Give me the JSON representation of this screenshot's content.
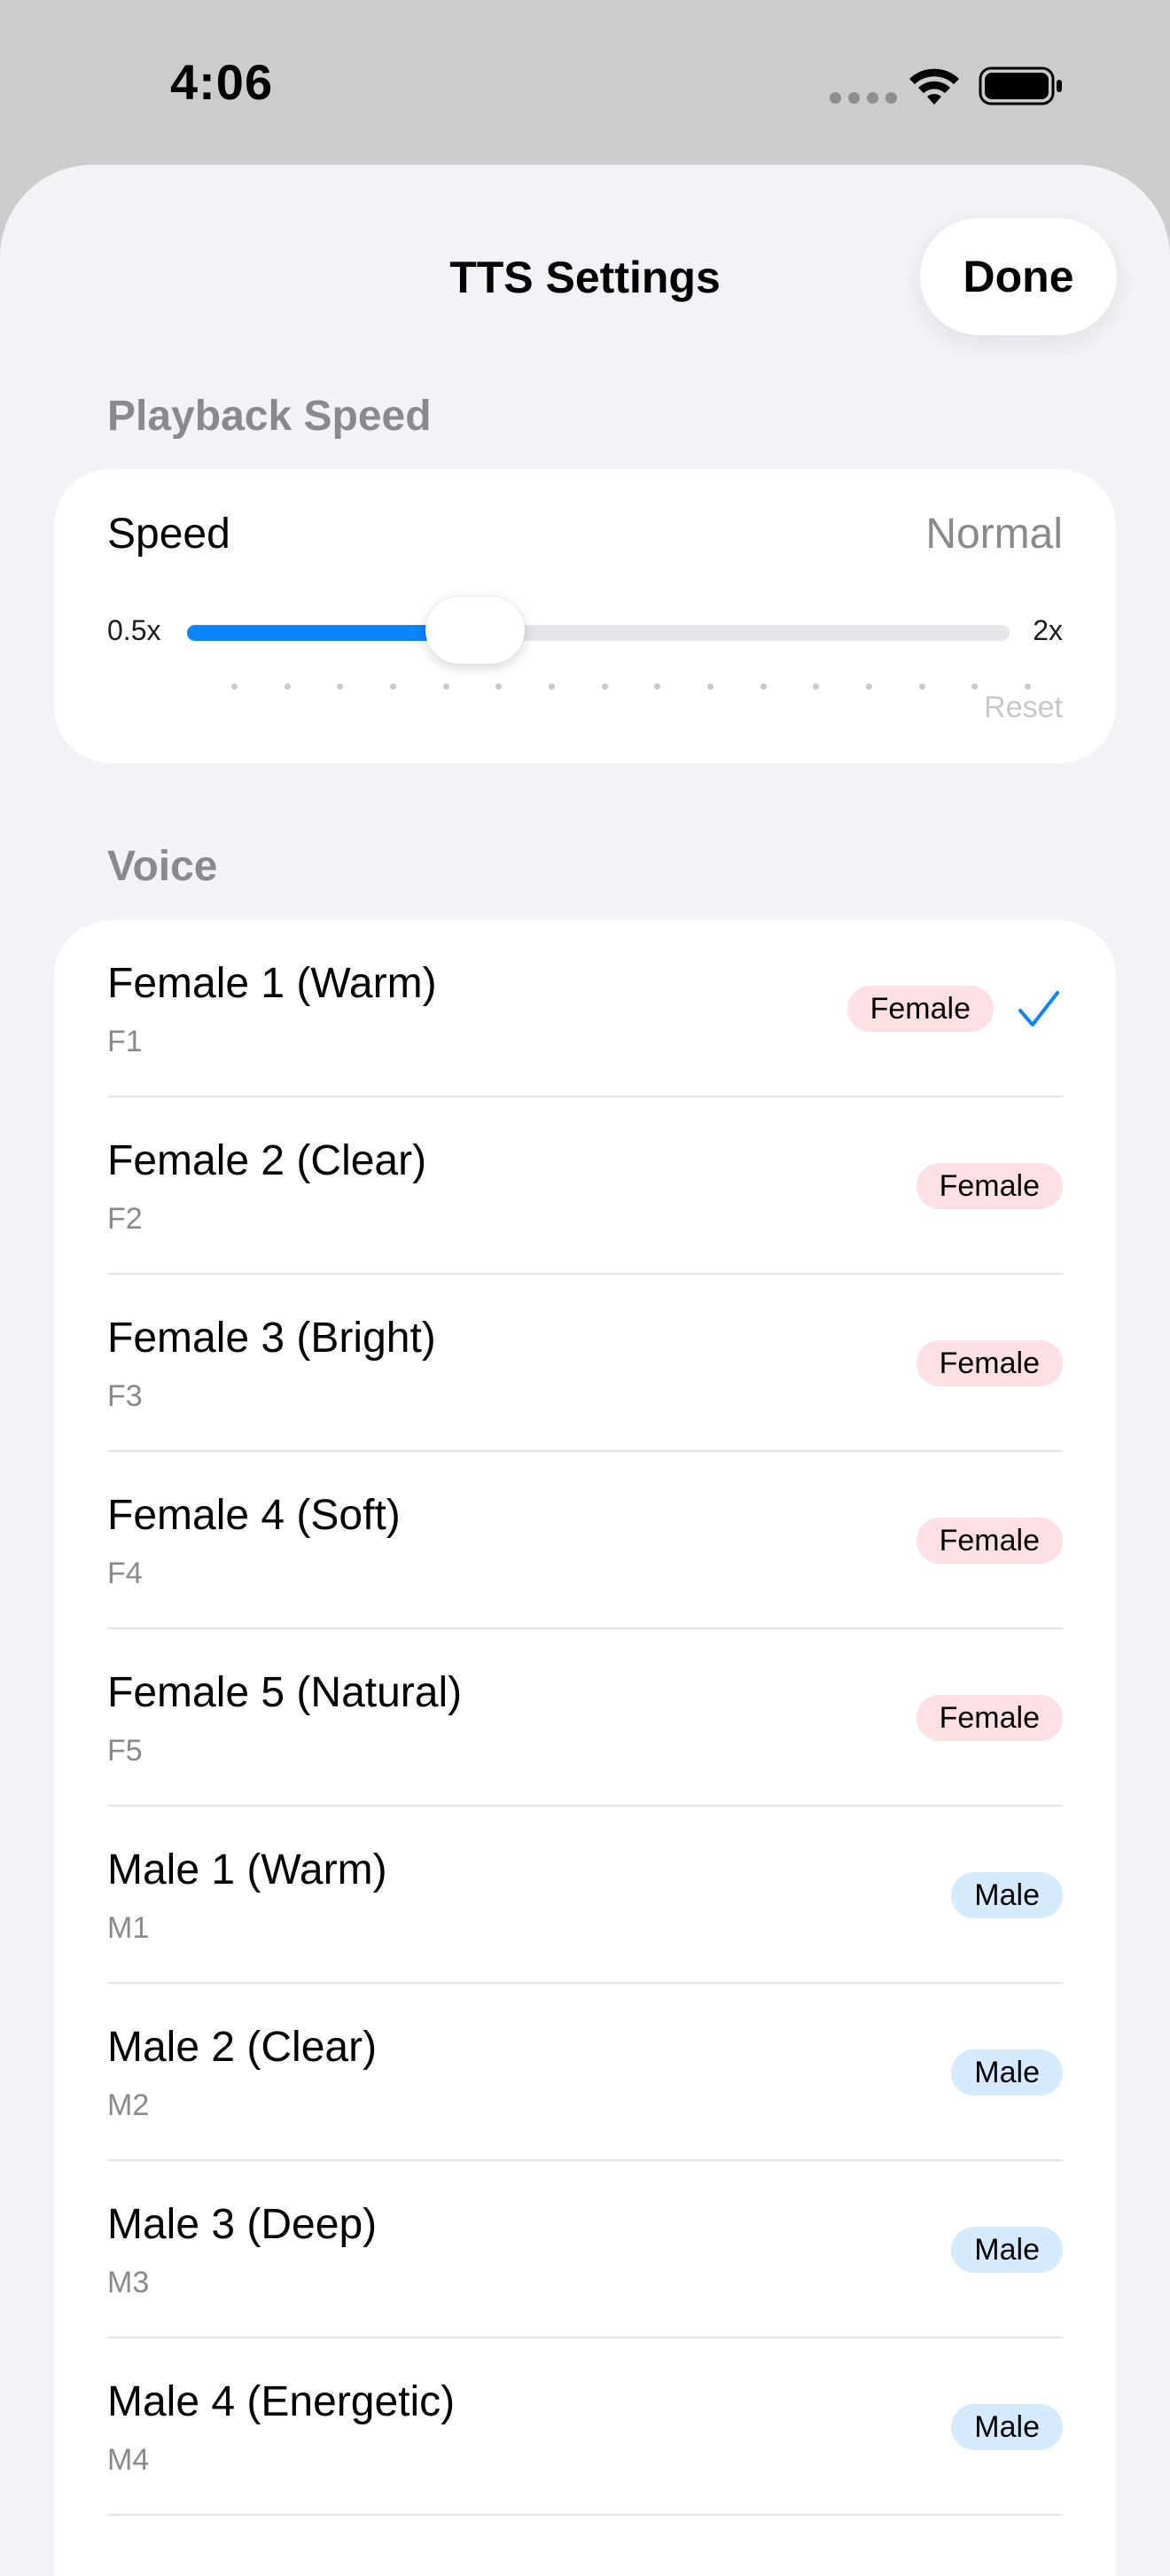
{
  "status_bar": {
    "time": "4:06",
    "wifi_icon": "wifi-icon",
    "battery_icon": "battery-icon"
  },
  "header": {
    "title": "TTS Settings",
    "done_label": "Done"
  },
  "playback": {
    "section_title": "Playback Speed",
    "speed_label": "Speed",
    "speed_value": "Normal",
    "min_label": "0.5x",
    "max_label": "2x",
    "reset_label": "Reset",
    "slider_position": 0.35,
    "accent_color": "#0a84ff"
  },
  "voice": {
    "section_title": "Voice",
    "selected_index": 0,
    "items": [
      {
        "name": "Female 1 (Warm)",
        "code": "F1",
        "gender": "Female",
        "selected": true
      },
      {
        "name": "Female 2 (Clear)",
        "code": "F2",
        "gender": "Female",
        "selected": false
      },
      {
        "name": "Female 3 (Bright)",
        "code": "F3",
        "gender": "Female",
        "selected": false
      },
      {
        "name": "Female 4 (Soft)",
        "code": "F4",
        "gender": "Female",
        "selected": false
      },
      {
        "name": "Female 5 (Natural)",
        "code": "F5",
        "gender": "Female",
        "selected": false
      },
      {
        "name": "Male 1 (Warm)",
        "code": "M1",
        "gender": "Male",
        "selected": false
      },
      {
        "name": "Male 2 (Clear)",
        "code": "M2",
        "gender": "Male",
        "selected": false
      },
      {
        "name": "Male 3 (Deep)",
        "code": "M3",
        "gender": "Male",
        "selected": false
      },
      {
        "name": "Male 4 (Energetic)",
        "code": "M4",
        "gender": "Male",
        "selected": false
      }
    ],
    "female_badge_color": "#fde0e4",
    "male_badge_color": "#d5eafd",
    "check_color": "#0a84ff"
  }
}
